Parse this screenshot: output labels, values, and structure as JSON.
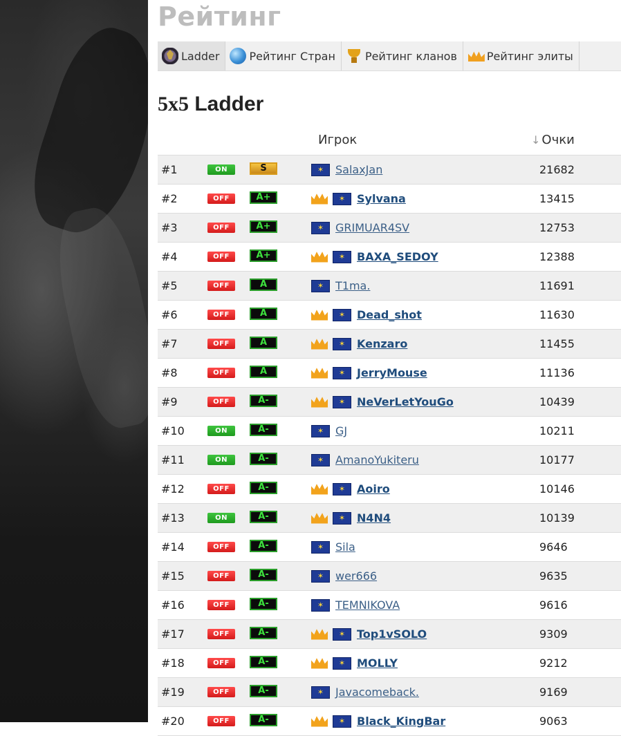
{
  "page": {
    "title": "Рейтинг"
  },
  "tabs": [
    {
      "label": "Ladder",
      "icon": "ladder-icon",
      "active": true
    },
    {
      "label": "Рейтинг Стран",
      "icon": "globe-icon",
      "active": false
    },
    {
      "label": "Рейтинг кланов",
      "icon": "trophy-icon",
      "active": false
    },
    {
      "label": "Рейтинг элиты",
      "icon": "crown-icon",
      "active": false
    }
  ],
  "ladder": {
    "title_prefix": "5x5",
    "title_suffix": " Ladder",
    "col_player": "Игрок",
    "col_points": "Очки",
    "sort_indicator": "↓",
    "rows": [
      {
        "rank": "#1",
        "status": "ON",
        "grade": "S",
        "elite": false,
        "name": "SalaxJan",
        "points": "21682"
      },
      {
        "rank": "#2",
        "status": "OFF",
        "grade": "A+",
        "elite": true,
        "name": "Sylvana",
        "points": "13415"
      },
      {
        "rank": "#3",
        "status": "OFF",
        "grade": "A+",
        "elite": false,
        "name": "GRIMUAR4SV",
        "points": "12753"
      },
      {
        "rank": "#4",
        "status": "OFF",
        "grade": "A+",
        "elite": true,
        "name": "BAXA_SEDOY",
        "points": "12388"
      },
      {
        "rank": "#5",
        "status": "OFF",
        "grade": "A",
        "elite": false,
        "name": "T1ma.",
        "points": "11691"
      },
      {
        "rank": "#6",
        "status": "OFF",
        "grade": "A",
        "elite": true,
        "name": "Dead_shot",
        "points": "11630"
      },
      {
        "rank": "#7",
        "status": "OFF",
        "grade": "A",
        "elite": true,
        "name": "Kenzaro",
        "points": "11455"
      },
      {
        "rank": "#8",
        "status": "OFF",
        "grade": "A",
        "elite": true,
        "name": "JerryMouse",
        "points": "11136"
      },
      {
        "rank": "#9",
        "status": "OFF",
        "grade": "A-",
        "elite": true,
        "name": "NeVerLetYouGo",
        "points": "10439"
      },
      {
        "rank": "#10",
        "status": "ON",
        "grade": "A-",
        "elite": false,
        "name": "GJ",
        "points": "10211"
      },
      {
        "rank": "#11",
        "status": "ON",
        "grade": "A-",
        "elite": false,
        "name": "AmanoYukiteru",
        "points": "10177"
      },
      {
        "rank": "#12",
        "status": "OFF",
        "grade": "A-",
        "elite": true,
        "name": "Aoiro",
        "points": "10146"
      },
      {
        "rank": "#13",
        "status": "ON",
        "grade": "A-",
        "elite": true,
        "name": "N4N4",
        "points": "10139"
      },
      {
        "rank": "#14",
        "status": "OFF",
        "grade": "A-",
        "elite": false,
        "name": "Sila",
        "points": "9646"
      },
      {
        "rank": "#15",
        "status": "OFF",
        "grade": "A-",
        "elite": false,
        "name": "wer666",
        "points": "9635"
      },
      {
        "rank": "#16",
        "status": "OFF",
        "grade": "A-",
        "elite": false,
        "name": "TEMNIKOVA",
        "points": "9616"
      },
      {
        "rank": "#17",
        "status": "OFF",
        "grade": "A-",
        "elite": true,
        "name": "Top1vSOLO",
        "points": "9309"
      },
      {
        "rank": "#18",
        "status": "OFF",
        "grade": "A-",
        "elite": true,
        "name": "MOLLY",
        "points": "9212"
      },
      {
        "rank": "#19",
        "status": "OFF",
        "grade": "A-",
        "elite": false,
        "name": "Javacomeback.",
        "points": "9169"
      },
      {
        "rank": "#20",
        "status": "OFF",
        "grade": "A-",
        "elite": true,
        "name": "Black_KingBar",
        "points": "9063"
      }
    ]
  },
  "colors": {
    "title_gray": "#bdbdbd",
    "link_blue": "#3b5f87",
    "status_on": "#2aa52a",
    "status_off": "#e02626",
    "grade_green": "#3ee23e"
  }
}
